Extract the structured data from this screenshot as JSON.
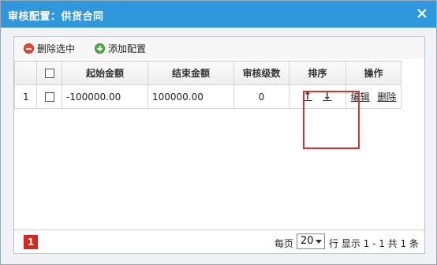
{
  "window": {
    "title": "审核配置：供货合同",
    "close_icon": "close-icon"
  },
  "toolbar": {
    "delete_label": "删除选中",
    "delete_icon": "minus-circle-icon",
    "add_label": "添加配置",
    "add_icon": "plus-circle-icon"
  },
  "table": {
    "columns": [
      "起始金额",
      "结束金额",
      "审核级数",
      "排序",
      "操作"
    ],
    "rows": [
      {
        "row_number": "1",
        "start_amount": "-100000.00",
        "end_amount": "100000.00",
        "levels": "0",
        "sort_up": "↑",
        "sort_down": "↓",
        "edit_label": "编辑",
        "delete_label": "删除"
      }
    ]
  },
  "footer": {
    "current_page": "1",
    "per_page_prefix": "每页",
    "per_page_value": "20",
    "per_page_suffix": "行 显示 1 - 1 共 1 条"
  },
  "colors": {
    "titlebar": "#2f98dc",
    "highlight": "#e03030",
    "page_badge": "#d9261c"
  }
}
